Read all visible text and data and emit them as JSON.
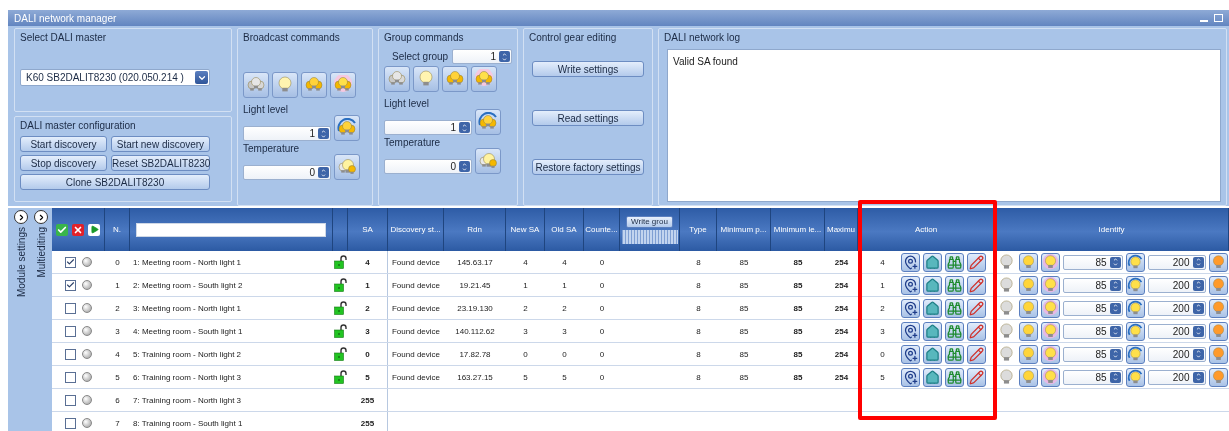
{
  "window": {
    "title": "DALI network manager"
  },
  "master": {
    "title": "Select DALI master",
    "device": "K60 SB2DALIT8230 (020.050.214 )"
  },
  "config": {
    "title": "DALI master configuration",
    "buttons": [
      "Start discovery",
      "Start new discovery",
      "Stop discovery",
      "Reset SB2DALIT8230",
      "Clone SB2DALIT8230"
    ]
  },
  "broadcast": {
    "title": "Broadcast commands",
    "light_level_label": "Light level",
    "light_level": "1",
    "temperature_label": "Temperature",
    "temperature": "0"
  },
  "group": {
    "title": "Group commands",
    "select_group_label": "Select group",
    "select_group": "1",
    "light_level_label": "Light level",
    "light_level": "1",
    "temperature_label": "Temperature",
    "temperature": "0"
  },
  "gear_editing": {
    "title": "Control gear editing",
    "buttons": [
      "Write settings",
      "Read settings",
      "Restore factory settings"
    ]
  },
  "log": {
    "title": "DALI network log",
    "lines": [
      "Valid SA found"
    ]
  },
  "side_tabs": [
    "Module settings",
    "Multiediting"
  ],
  "table": {
    "columns": [
      {
        "kind": "select"
      },
      {
        "kind": "text",
        "label": "N."
      },
      {
        "kind": "filter"
      },
      {
        "kind": "blank"
      },
      {
        "kind": "text",
        "label": "SA"
      },
      {
        "kind": "text",
        "label": "Discovery st..."
      },
      {
        "kind": "text",
        "label": "Rdn"
      },
      {
        "kind": "text",
        "label": "New SA"
      },
      {
        "kind": "text",
        "label": "Old SA"
      },
      {
        "kind": "text",
        "label": "Counte..."
      },
      {
        "kind": "button",
        "label": "Write grou"
      },
      {
        "kind": "text",
        "label": "Type"
      },
      {
        "kind": "text",
        "label": "Minimum p..."
      },
      {
        "kind": "text",
        "label": "Minimum le..."
      },
      {
        "kind": "text",
        "label": "Maximu"
      },
      {
        "kind": "text",
        "label": "Action",
        "highlighted": true
      },
      {
        "kind": "text",
        "label": "Identify"
      }
    ],
    "rows": [
      {
        "checked": true,
        "n": "0",
        "name": "1: Meeting room - North light 1",
        "unlocked": true,
        "sa": "4",
        "details": [
          "Found device",
          "145.63.17",
          "4",
          "4",
          "0"
        ],
        "settings": [
          "8",
          "85",
          "85",
          "254"
        ],
        "action_sa": "4",
        "identify": [
          "85",
          "200"
        ]
      },
      {
        "checked": true,
        "n": "1",
        "name": "2: Meeting room - South light  2",
        "unlocked": true,
        "sa": "1",
        "details": [
          "Found device",
          "19.21.45",
          "1",
          "1",
          "0"
        ],
        "settings": [
          "8",
          "85",
          "85",
          "254"
        ],
        "action_sa": "1",
        "identify": [
          "85",
          "200"
        ]
      },
      {
        "checked": false,
        "n": "2",
        "name": "3: Meeting room - North light  1",
        "unlocked": true,
        "sa": "2",
        "details": [
          "Found device",
          "23.19.130",
          "2",
          "2",
          "0"
        ],
        "settings": [
          "8",
          "85",
          "85",
          "254"
        ],
        "action_sa": "2",
        "identify": [
          "85",
          "200"
        ]
      },
      {
        "checked": false,
        "n": "3",
        "name": "4: Meeting room - South light 1",
        "unlocked": true,
        "sa": "3",
        "details": [
          "Found device",
          "140.112.62",
          "3",
          "3",
          "0"
        ],
        "settings": [
          "8",
          "85",
          "85",
          "254"
        ],
        "action_sa": "3",
        "identify": [
          "85",
          "200"
        ]
      },
      {
        "checked": false,
        "n": "4",
        "name": "5: Training room - North light 2",
        "unlocked": true,
        "sa": "0",
        "details": [
          "Found device",
          "17.82.78",
          "0",
          "0",
          "0"
        ],
        "settings": [
          "8",
          "85",
          "85",
          "254"
        ],
        "action_sa": "0",
        "identify": [
          "85",
          "200"
        ]
      },
      {
        "checked": false,
        "n": "5",
        "name": "6: Training room - North light 3",
        "unlocked": true,
        "sa": "5",
        "details": [
          "Found device",
          "163.27.15",
          "5",
          "5",
          "0"
        ],
        "settings": [
          "8",
          "85",
          "85",
          "254"
        ],
        "action_sa": "5",
        "identify": [
          "85",
          "200"
        ]
      },
      {
        "checked": false,
        "n": "6",
        "name": "7: Training room - North light 3",
        "unlocked": false,
        "sa": "255"
      },
      {
        "checked": false,
        "n": "7",
        "name": "8: Training room - South light 1",
        "unlocked": false,
        "sa": "255"
      }
    ]
  }
}
